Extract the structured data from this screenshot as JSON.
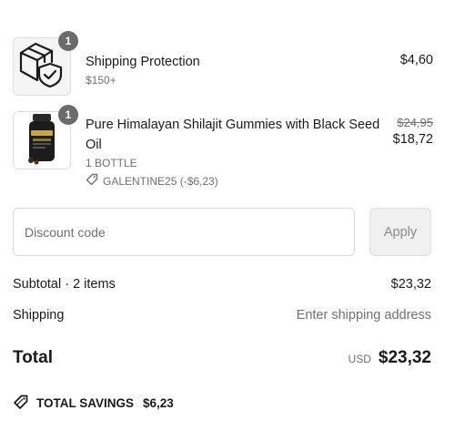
{
  "items": [
    {
      "title": "Shipping Protection",
      "variant": "$150+",
      "quantity": "1",
      "price": "$4,60",
      "icon": "package-shield-icon"
    },
    {
      "title": "Pure Himalayan Shilajit Gummies with Black Seed Oil",
      "variant": "1 BOTTLE",
      "quantity": "1",
      "original_price": "$24,95",
      "price": "$18,72",
      "discount": "GALENTINE25 (-$6,23)",
      "icon": "supplement-bottle-image"
    }
  ],
  "discount": {
    "placeholder": "Discount code",
    "apply_label": "Apply"
  },
  "summary": {
    "subtotal_label": "Subtotal · 2 items",
    "subtotal_value": "$23,32",
    "shipping_label": "Shipping",
    "shipping_value": "Enter shipping address",
    "total_label": "Total",
    "currency": "USD",
    "total_value": "$23,32",
    "savings_label": "TOTAL SAVINGS",
    "savings_value": "$6,23"
  },
  "colors": {
    "text": "#1a1a1a",
    "muted": "#707070",
    "badge": "#6b6b6b",
    "border": "#d9d9d9"
  }
}
